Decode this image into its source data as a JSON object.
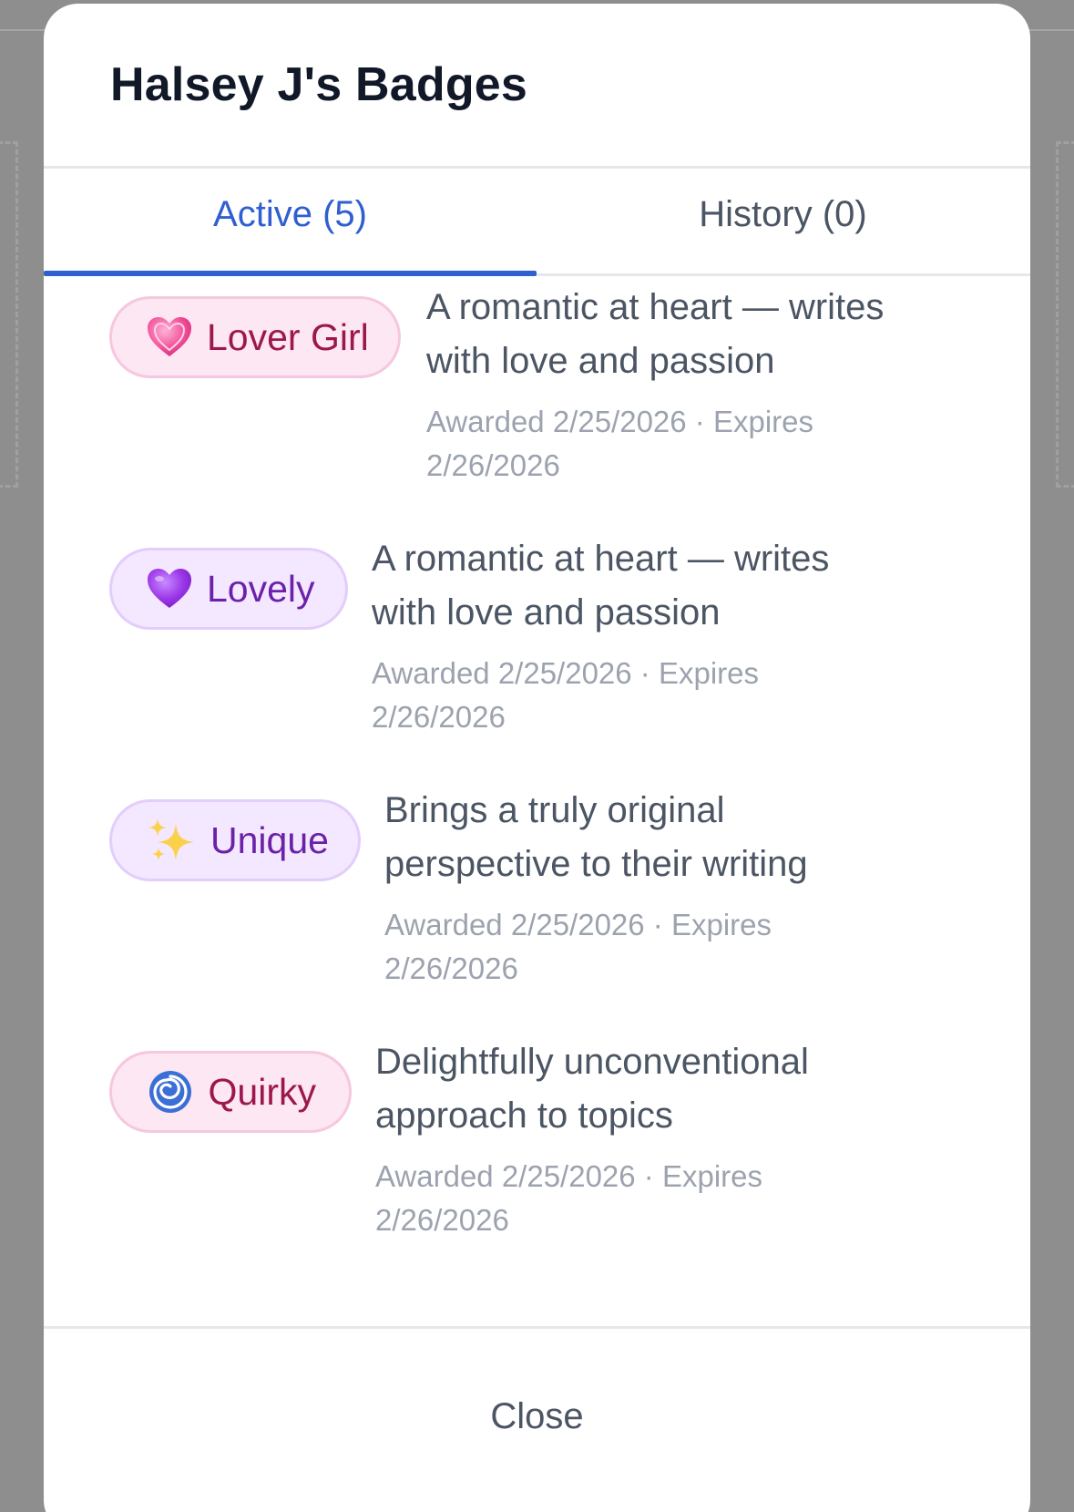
{
  "dialog": {
    "title": "Halsey J's Badges",
    "close_label": "Close"
  },
  "tabs": [
    {
      "label": "Active (5)",
      "active": true
    },
    {
      "label": "History (0)",
      "active": false
    }
  ],
  "badges": [
    {
      "name": "Lover Girl",
      "icon": "pink-heart-icon",
      "description_lines": [
        "A romantic at heart — writes",
        "with love and passion"
      ],
      "meta_lines": [
        "Awarded 2/25/2026 · Expires",
        "2/26/2026"
      ]
    },
    {
      "name": "Lovely",
      "icon": "purple-heart-icon",
      "description_lines": [
        "A romantic at heart — writes",
        "with love and passion"
      ],
      "meta_lines": [
        "Awarded 2/25/2026 · Expires",
        "2/26/2026"
      ]
    },
    {
      "name": "Unique",
      "icon": "sparkles-icon",
      "description_lines": [
        "Brings a truly original",
        "perspective to their writing"
      ],
      "meta_lines": [
        "Awarded 2/25/2026 · Expires",
        "2/26/2026"
      ]
    },
    {
      "name": "Quirky",
      "icon": "cyclone-icon",
      "description_lines": [
        "Delightfully unconventional",
        "approach to topics"
      ],
      "meta_lines": [
        "Awarded 2/25/2026 · Expires",
        "2/26/2026"
      ]
    }
  ],
  "colors": {
    "accent": "#2f5fd0",
    "pink_pill_bg": "#fce7f3",
    "pink_pill_text": "#9d174d",
    "violet_pill_bg": "#f3e8ff",
    "violet_pill_text": "#6b21a8"
  }
}
